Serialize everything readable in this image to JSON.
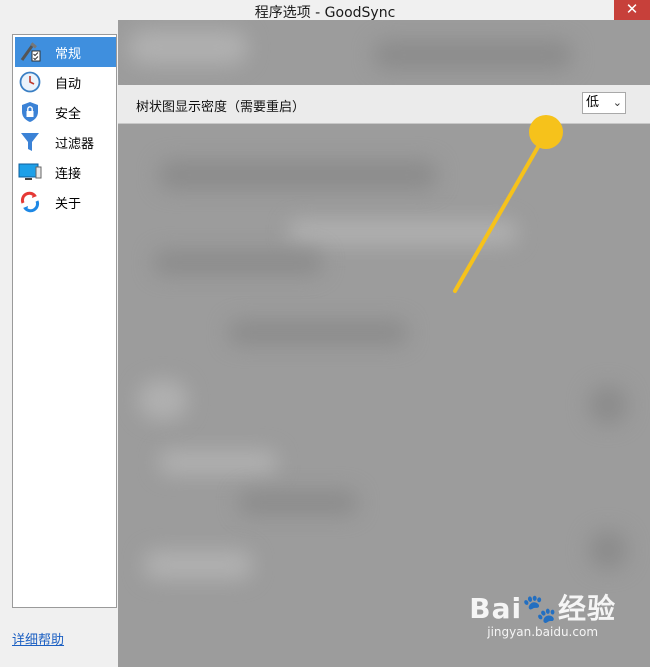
{
  "window": {
    "title": "程序选项 - GoodSync",
    "close_glyph": "✕"
  },
  "sidebar": {
    "items": [
      {
        "label": "常规",
        "icon": "general-tools-icon",
        "selected": true
      },
      {
        "label": "自动",
        "icon": "clock-icon",
        "selected": false
      },
      {
        "label": "安全",
        "icon": "shield-lock-icon",
        "selected": false
      },
      {
        "label": "过滤器",
        "icon": "filter-funnel-icon",
        "selected": false
      },
      {
        "label": "连接",
        "icon": "monitor-icon",
        "selected": false
      },
      {
        "label": "关于",
        "icon": "goodsync-logo-icon",
        "selected": false
      }
    ]
  },
  "help_link": "详细帮助",
  "setting": {
    "label": "树状图显示密度（需要重启）",
    "value": "低"
  },
  "colors": {
    "selection": "#3f8fde",
    "overlay": "#9c9c9c",
    "annotation": "#f6c21b",
    "link": "#1b5fc2"
  },
  "watermark": {
    "logo": "Bai🐾经验",
    "url": "jingyan.baidu.com"
  }
}
